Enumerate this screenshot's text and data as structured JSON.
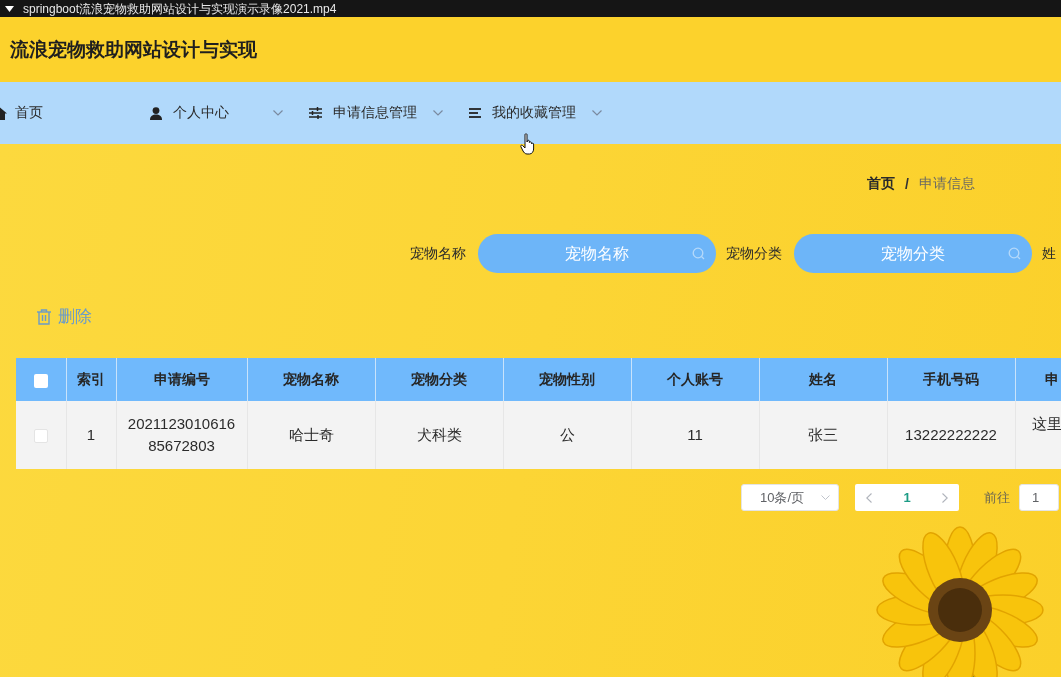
{
  "video_bar": {
    "title": "springboot流浪宠物救助网站设计与实现演示录像2021.mp4"
  },
  "header": {
    "title": "流浪宠物救助网站设计与实现"
  },
  "nav": {
    "items": [
      {
        "label": "首页",
        "dropdown": false
      },
      {
        "label": "个人中心",
        "dropdown": true
      },
      {
        "label": "申请信息管理",
        "dropdown": true
      },
      {
        "label": "我的收藏管理",
        "dropdown": true
      }
    ]
  },
  "breadcrumb": {
    "separator": "/",
    "items": [
      {
        "label": "首页",
        "current": false
      },
      {
        "label": "申请信息",
        "current": true
      }
    ]
  },
  "search": {
    "fields": [
      {
        "label": "宠物名称",
        "placeholder": "宠物名称"
      },
      {
        "label": "宠物分类",
        "placeholder": "宠物分类"
      },
      {
        "label": "姓"
      }
    ]
  },
  "toolbar": {
    "delete_button": "删除"
  },
  "table": {
    "select_all_checked": false,
    "columns": [
      "索引",
      "申请编号",
      "宠物名称",
      "宠物分类",
      "宠物性别",
      "个人账号",
      "姓名",
      "手机号码",
      "申"
    ],
    "rows": [
      {
        "checked": false,
        "cells": [
          "1",
          "202112301061685672803",
          "哈士奇",
          "犬科类",
          "公",
          "11",
          "张三",
          "13222222222",
          "这里"
        ]
      }
    ]
  },
  "pagination": {
    "page_size": "10条/页",
    "pages": [
      {
        "label": "1",
        "selected": true
      }
    ],
    "goto_label": "前往",
    "goto_value": "1"
  }
}
